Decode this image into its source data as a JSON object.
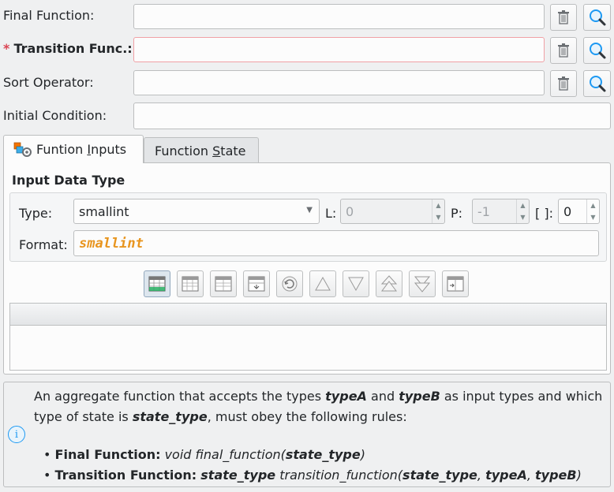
{
  "fields": {
    "final_function": {
      "label": "Final Function:",
      "value": ""
    },
    "transition_func": {
      "required_mark": "*",
      "label": "Transition Func.:",
      "value": ""
    },
    "sort_operator": {
      "label": "Sort Operator:",
      "value": ""
    },
    "initial_condition": {
      "label": "Initial Condition:",
      "value": ""
    }
  },
  "tabs": [
    {
      "label": "Funtion Inputs",
      "mnemonic": "I",
      "active": true
    },
    {
      "label": "Function State",
      "mnemonic": "S",
      "active": false
    }
  ],
  "input_data_type": {
    "title": "Input Data Type",
    "type_label": "Type:",
    "type_value": "smallint",
    "length_label": "L:",
    "length_value": "0",
    "precision_label": "P:",
    "precision_value": "-1",
    "dimension_label": "[ ]:",
    "dimension_value": "0",
    "format_label": "Format:",
    "format_value": "smallint"
  },
  "toolbar": {
    "buttons": [
      "add-row",
      "remove-row",
      "clear-table",
      "edit-row",
      "refresh",
      "move-up",
      "move-down",
      "move-top",
      "move-bottom",
      "copy-row"
    ]
  },
  "info": {
    "line1_a": "An aggregate function that accepts the types ",
    "line1_b": "typeA",
    "line1_c": " and ",
    "line1_d": "typeB",
    "line1_e": " as input types and which",
    "line2_a": "type of state is ",
    "line2_b": "state_type",
    "line2_c": ", must obey the following rules:",
    "rule1_label": "Final Function:",
    "rule1_a": " void final_function(",
    "rule1_b": "state_type",
    "rule1_c": ")",
    "rule2_label": "Transition Function:",
    "rule2_a": "state_type",
    "rule2_b": " transition_function(",
    "rule2_c": "state_type",
    "rule2_d": ", ",
    "rule2_e": "typeA",
    "rule2_f": ", ",
    "rule2_g": "typeB",
    "rule2_h": ")"
  },
  "colors": {
    "accent": "#3daee9",
    "required": "#da4453",
    "format_text": "#e8951f"
  }
}
